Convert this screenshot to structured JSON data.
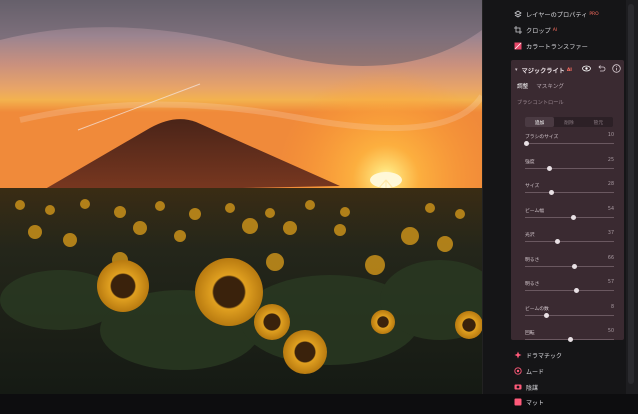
{
  "panel": {
    "top_items": [
      {
        "label": "レイヤーのプロパティ",
        "badge": "PRO",
        "icon": "layers-icon"
      },
      {
        "label": "クロップ",
        "badge": "AI",
        "icon": "crop-icon"
      },
      {
        "label": "カラートランスファー",
        "badge": "",
        "icon": "color-transfer-icon"
      }
    ],
    "magic_light": {
      "title": "マジックライト",
      "badge": "AI",
      "tabs": [
        "調整",
        "マスキング"
      ],
      "active_tab": 0,
      "brush_control_title": "ブラシコントロール",
      "segments": [
        "追加",
        "削除",
        "管元"
      ],
      "active_segment": 0,
      "sliders": [
        {
          "label": "ブラシのサイズ",
          "value": "10",
          "fraction": 0.02
        },
        {
          "label": "強度",
          "value": "25",
          "fraction": 0.27
        },
        {
          "label": "サイズ",
          "value": "28",
          "fraction": 0.3
        },
        {
          "label": "ビーム幅",
          "value": "54",
          "fraction": 0.54
        },
        {
          "label": "光沢",
          "value": "37",
          "fraction": 0.37
        },
        {
          "label": "明るさ",
          "value": "66",
          "fraction": 0.56
        },
        {
          "label": "明るさ",
          "value": "57",
          "fraction": 0.58
        },
        {
          "label": "ビームの数",
          "value": "8",
          "fraction": 0.24
        },
        {
          "label": "回転",
          "value": "50",
          "fraction": 0.51
        }
      ]
    },
    "footer_items": [
      {
        "label": "ドラマチック",
        "icon": "drama-icon"
      },
      {
        "label": "ムード",
        "icon": "mood-icon"
      },
      {
        "label": "陰謀",
        "icon": "intrigue-icon"
      },
      {
        "label": "マット",
        "icon": "matte-icon"
      }
    ]
  },
  "colors": {
    "accent": "#ff5a5f",
    "section_bg": "#3a2a31",
    "panel_bg": "#151517"
  }
}
